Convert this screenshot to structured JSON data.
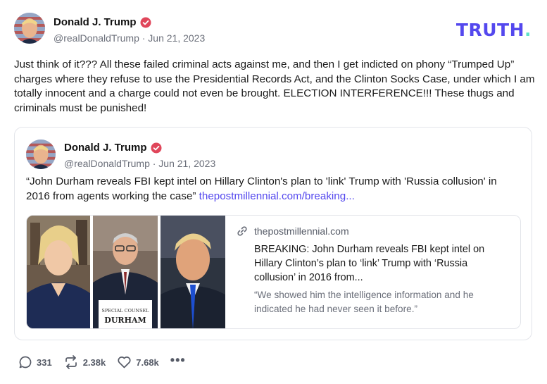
{
  "brand": {
    "logo_text": "TRUTH",
    "logo_dot": ".",
    "primary_color": "#5448ee",
    "accent_color": "#5fe3c7"
  },
  "post": {
    "author": {
      "name": "Donald J. Trump",
      "handle": "@realDonaldTrump",
      "date": "Jun 21, 2023",
      "handle_line": "@realDonaldTrump · Jun 21, 2023"
    },
    "text": "Just think of it??? All these failed criminal acts against me, and then I get indicted on phony “Trumped Up” charges where they refuse to use the Presidential Records Act, and the Clinton Socks Case, under which I am totally innocent and a charge could not even be brought. ELECTION INTERFERENCE!!! These thugs and criminals must be punished!"
  },
  "quoted_post": {
    "author": {
      "name": "Donald J. Trump",
      "handle_line": "@realDonaldTrump · Jun 21, 2023"
    },
    "text": "“John Durham reveals FBI kept intel on Hillary Clinton's plan to 'link' Trump with 'Russia collusion' in 2016 from agents working the case” ",
    "link_text": "thepostmillennial.com/breaking...",
    "link_card": {
      "domain": "thepostmillennial.com",
      "title": "BREAKING: John Durham reveals FBI kept intel on Hillary Clinton’s plan to ‘link’ Trump with ‘Russia collusion’ in 2016 from...",
      "description": "“We showed him the intelligence information and he indicated he had never seen it before.”",
      "placard_line1": "SPECIAL COUNSEL",
      "placard_line2": "DURHAM"
    }
  },
  "actions": {
    "replies": "331",
    "retruths": "2.38k",
    "likes": "7.68k",
    "more": "•••"
  },
  "icons": {
    "verified": "verified-badge-icon",
    "reply": "speech-bubble-icon",
    "retruth": "repost-arrows-icon",
    "like": "heart-icon",
    "link": "link-chain-icon",
    "more": "ellipsis-icon"
  }
}
